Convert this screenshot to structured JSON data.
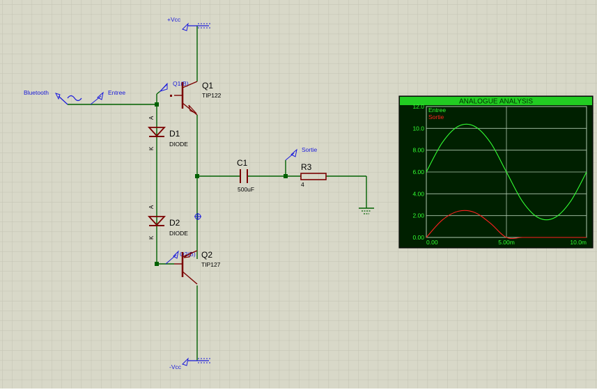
{
  "power": {
    "vcc_pos": "+Vcc",
    "vcc_neg": "-Vcc"
  },
  "generator": {
    "label": "Bluetooth"
  },
  "probes": {
    "input": "Entree",
    "output": "Sortie",
    "q1_base": "Q1(B)",
    "q2_base": "Q2(B)"
  },
  "components": {
    "q1": {
      "ref": "Q1",
      "value": "TIP122"
    },
    "q2": {
      "ref": "Q2",
      "value": "TIP127"
    },
    "d1": {
      "ref": "D1",
      "value": "DIODE",
      "anode": "A",
      "cathode": "K"
    },
    "d2": {
      "ref": "D2",
      "value": "DIODE",
      "anode": "A",
      "cathode": "K"
    },
    "c1": {
      "ref": "C1",
      "value": "500uF"
    },
    "r3": {
      "ref": "R3",
      "value": "4"
    }
  },
  "graph": {
    "title": "ANALOGUE ANALYSIS",
    "y_ticks": [
      "12.0",
      "10.0",
      "8.00",
      "6.00",
      "4.00",
      "2.00",
      "0.00"
    ],
    "x_ticks": [
      "0.00",
      "5.00m",
      "10.0m"
    ],
    "colors": {
      "entree": "#33ff33",
      "sortie": "#ff2020",
      "title_bar": "#22cc22",
      "plot_bg": "#002000"
    }
  },
  "chart_data": {
    "type": "line",
    "title": "ANALOGUE ANALYSIS",
    "x": [
      0,
      0.001,
      0.002,
      0.003,
      0.004,
      0.005,
      0.006,
      0.007,
      0.008,
      0.009,
      0.01
    ],
    "series": [
      {
        "name": "Entree",
        "values": [
          6.0,
          8.7,
          10.2,
          10.2,
          8.7,
          6.0,
          3.3,
          1.8,
          1.8,
          3.3,
          6.0
        ]
      },
      {
        "name": "Sortie",
        "values": [
          0.0,
          1.6,
          2.4,
          2.3,
          1.3,
          0.0,
          0.0,
          0.0,
          0.0,
          0.0,
          0.0
        ]
      }
    ],
    "xlim": [
      0,
      0.01
    ],
    "ylim": [
      0,
      12
    ],
    "grid": true,
    "legend": "top-left"
  }
}
